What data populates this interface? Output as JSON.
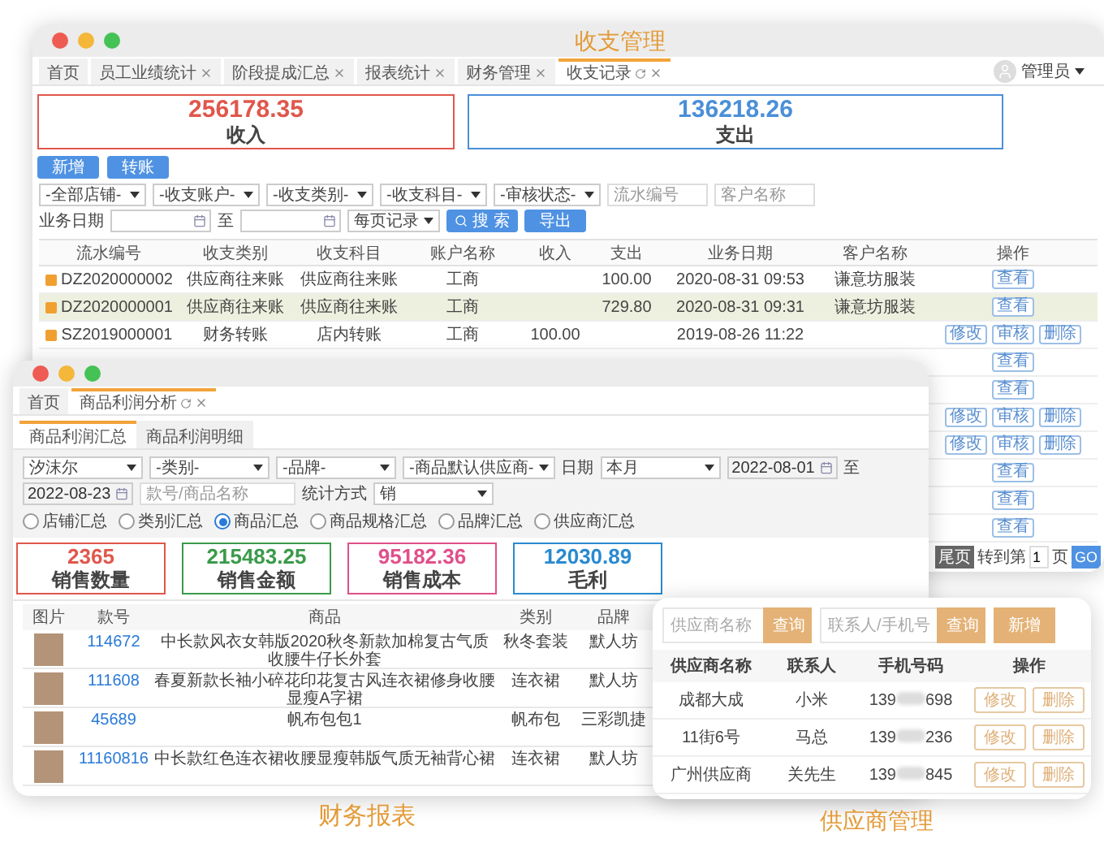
{
  "ledger_window": {
    "caption": "收支管理",
    "tabs": [
      {
        "label": "首页",
        "selected": false,
        "refresh": false,
        "closable": false
      },
      {
        "label": "员工业绩统计",
        "selected": false,
        "refresh": false,
        "closable": true
      },
      {
        "label": "阶段提成汇总",
        "selected": false,
        "refresh": false,
        "closable": true
      },
      {
        "label": "报表统计",
        "selected": false,
        "refresh": false,
        "closable": true
      },
      {
        "label": "财务管理",
        "selected": false,
        "refresh": false,
        "closable": true
      },
      {
        "label": "收支记录",
        "selected": true,
        "refresh": true,
        "closable": true
      }
    ],
    "user": "管理员",
    "totals": [
      {
        "value": "256178.35",
        "label": "收入",
        "color": "#e0574c"
      },
      {
        "value": "136218.26",
        "label": "支出",
        "color": "#4a8fd8"
      }
    ],
    "buttons": [
      "新增",
      "转账"
    ],
    "filters": [
      {
        "kind": "select",
        "value": "-全部店铺-"
      },
      {
        "kind": "select",
        "value": "-收支账户-"
      },
      {
        "kind": "select",
        "value": "-收支类别-"
      },
      {
        "kind": "select",
        "value": "-收支科目-"
      },
      {
        "kind": "select",
        "value": "-审核状态-"
      },
      {
        "kind": "input",
        "placeholder": "流水编号"
      },
      {
        "kind": "input",
        "placeholder": "客户名称"
      }
    ],
    "date_filter": {
      "label": "业务日期",
      "separator": "至",
      "page_size": "每页记录",
      "search": "搜 索",
      "export": "导出"
    },
    "table": {
      "columns": [
        "流水编号",
        "收支类别",
        "收支科目",
        "账户名称",
        "收入",
        "支出",
        "业务日期",
        "客户名称",
        "操作"
      ],
      "rows": [
        {
          "selected": false,
          "cells": [
            "DZ2020000002",
            "供应商往来账",
            "供应商往来账",
            "工商",
            null,
            "100.00",
            "2020-08-31 09:53",
            "谦意坊服装"
          ],
          "actions": [
            "查看"
          ]
        },
        {
          "selected": true,
          "cells": [
            "DZ2020000001",
            "供应商往来账",
            "供应商往来账",
            "工商",
            null,
            "729.80",
            "2020-08-31 09:31",
            "谦意坊服装"
          ],
          "actions": [
            "查看"
          ]
        },
        {
          "selected": false,
          "cells": [
            "SZ2019000001",
            "财务转账",
            "店内转账",
            "工商",
            "100.00",
            null,
            "2019-08-26 11:22",
            null
          ],
          "actions": [
            "修改",
            "审核",
            "删除"
          ]
        },
        {
          "selected": false,
          "actions": [
            "查看"
          ]
        },
        {
          "selected": false,
          "actions": [
            "查看"
          ]
        },
        {
          "selected": false,
          "actions": [
            "修改",
            "审核",
            "删除"
          ]
        },
        {
          "selected": false,
          "actions": [
            "修改",
            "审核",
            "删除"
          ]
        },
        {
          "selected": false,
          "actions": [
            "查看"
          ]
        },
        {
          "selected": false,
          "actions": [
            "查看"
          ]
        },
        {
          "selected": false,
          "actions": [
            "查看"
          ]
        }
      ]
    },
    "pagination": {
      "last": "尾页",
      "goto": "转到第",
      "page": "1",
      "unit": "页",
      "go": "GO"
    }
  },
  "profit_window": {
    "caption": "财务报表",
    "tabs": [
      {
        "label": "首页",
        "selected": false,
        "refresh": false,
        "closable": false
      },
      {
        "label": "商品利润分析",
        "selected": true,
        "refresh": true,
        "closable": true
      }
    ],
    "subtabs": [
      {
        "label": "商品利润汇总",
        "selected": true
      },
      {
        "label": "商品利润明细",
        "selected": false
      }
    ],
    "filters": [
      {
        "kind": "select",
        "value": "汐沫尔"
      },
      {
        "kind": "select",
        "value": "-类别-"
      },
      {
        "kind": "select",
        "value": "-品牌-"
      },
      {
        "kind": "select",
        "value": "-商品默认供应商-"
      },
      {
        "kind": "label",
        "text": "日期"
      },
      {
        "kind": "select",
        "value": "本月"
      },
      {
        "kind": "date",
        "value": "2022-08-01"
      },
      {
        "kind": "label",
        "text": "至"
      },
      {
        "kind": "date",
        "value": "2022-08-23"
      },
      {
        "kind": "input",
        "placeholder": "款号/商品名称"
      },
      {
        "kind": "label",
        "text": "统计方式"
      },
      {
        "kind": "select",
        "value": "销"
      }
    ],
    "modes": [
      {
        "label": "店铺汇总",
        "selected": false
      },
      {
        "label": "类别汇总",
        "selected": false
      },
      {
        "label": "商品汇总",
        "selected": true
      },
      {
        "label": "商品规格汇总",
        "selected": false
      },
      {
        "label": "品牌汇总",
        "selected": false
      },
      {
        "label": "供应商汇总",
        "selected": false
      }
    ],
    "totals": [
      {
        "value": "2365",
        "label": "销售数量",
        "color": "#e0574c"
      },
      {
        "value": "215483.25",
        "label": "销售金额",
        "color": "#3a9a4a"
      },
      {
        "value": "95182.36",
        "label": "销售成本",
        "color": "#e0508a"
      },
      {
        "value": "12030.89",
        "label": "毛利",
        "color": "#2a8ad0"
      }
    ],
    "table": {
      "columns": [
        "图片",
        "款号",
        "商品",
        "类别",
        "品牌"
      ],
      "rows": [
        {
          "code": "114672",
          "name": "中长款风衣女韩版2020秋冬新款加棉复古气质收腰牛仔长外套",
          "category": "秋冬套装",
          "brand": "默人坊"
        },
        {
          "code": "111608",
          "name": "春夏新款长袖小碎花印花复古风连衣裙修身收腰显瘦A字裙",
          "category": "连衣裙",
          "brand": "默人坊"
        },
        {
          "code": "45689",
          "name": "帆布包包1",
          "category": "帆布包",
          "brand": "三彩凯捷"
        },
        {
          "code": "11160816",
          "name": "中长款红色连衣裙收腰显瘦韩版气质无袖背心裙",
          "category": "连衣裙",
          "brand": "默人坊"
        }
      ]
    }
  },
  "supplier_window": {
    "caption": "供应商管理",
    "search": [
      {
        "placeholder": "供应商名称",
        "button": "查询"
      },
      {
        "placeholder": "联系人/手机号",
        "button": "查询"
      }
    ],
    "add": "新增",
    "columns": [
      "供应商名称",
      "联系人",
      "手机号码",
      "操作"
    ],
    "rows": [
      {
        "name": "成都大成",
        "contact": "小米",
        "phone_start": "139",
        "phone_end": "698",
        "actions": [
          "修改",
          "删除"
        ]
      },
      {
        "name": "11街6号",
        "contact": "马总",
        "phone_start": "139",
        "phone_end": "236",
        "actions": [
          "修改",
          "删除"
        ]
      },
      {
        "name": "广州供应商",
        "contact": "关先生",
        "phone_start": "139",
        "phone_end": "845",
        "actions": [
          "修改",
          "删除"
        ]
      }
    ]
  }
}
